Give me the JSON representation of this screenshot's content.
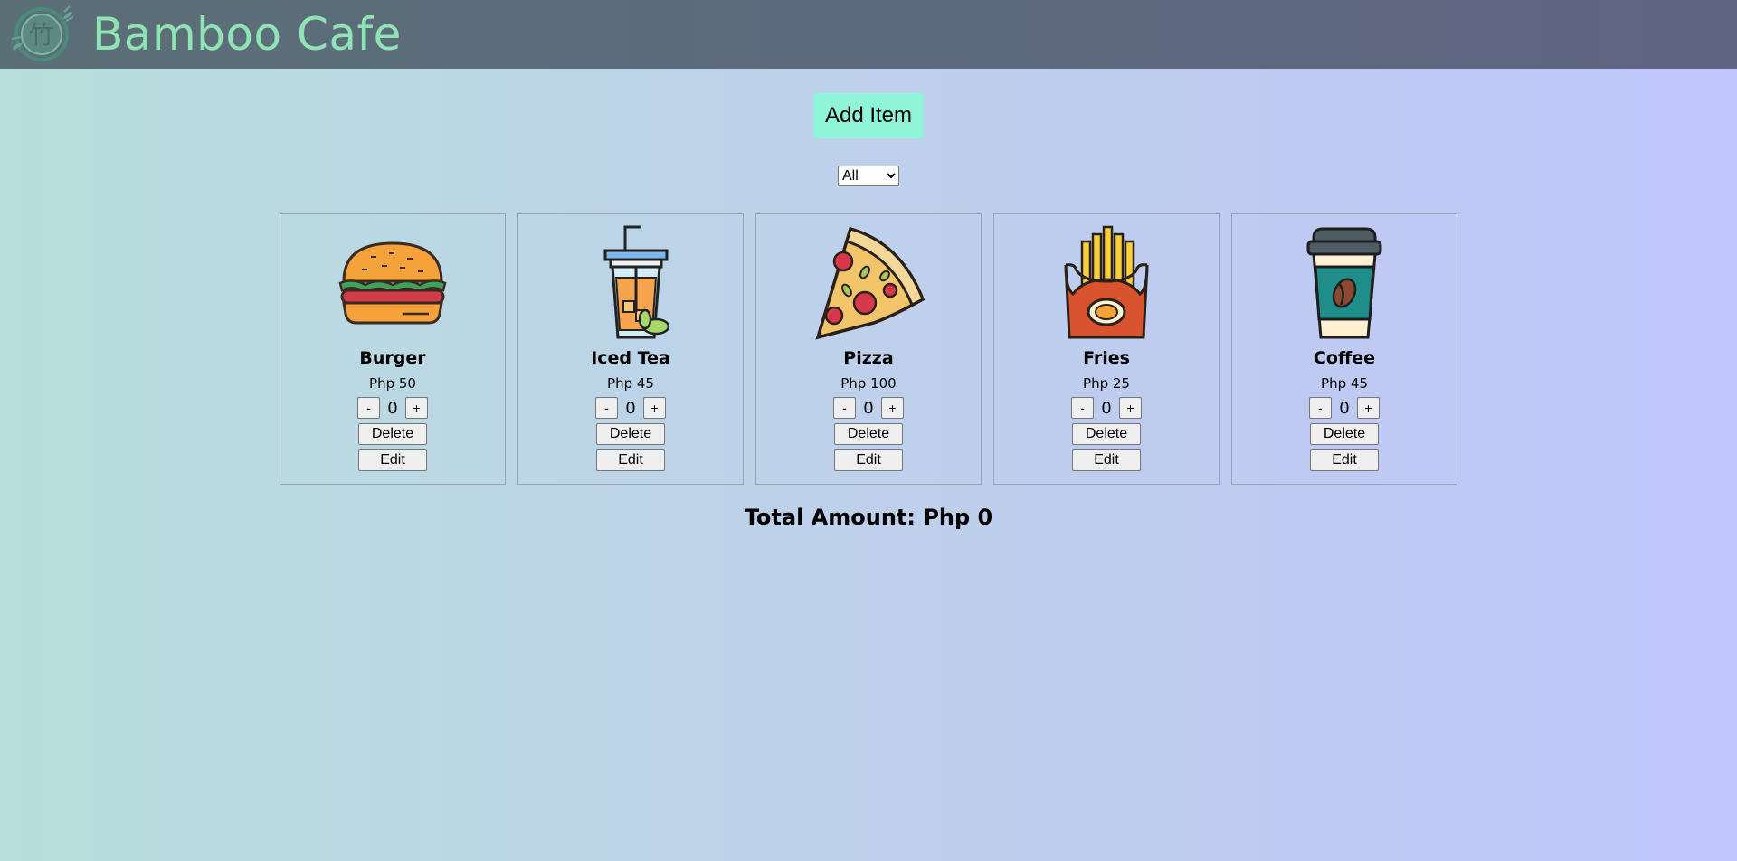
{
  "header": {
    "brand": "Bamboo Cafe",
    "logo_icon": "bamboo-logo-icon",
    "colors": {
      "bar": "#5d6a7e",
      "brand_text": "#8fe3b4"
    }
  },
  "toolbar": {
    "add_item_label": "Add Item",
    "add_button_color": "#90f4d9"
  },
  "filter": {
    "selected": "All"
  },
  "items": [
    {
      "name": "Burger",
      "price": "Php 50",
      "qty": "0",
      "icon": "burger-icon",
      "minus": "-",
      "plus": "+",
      "delete": "Delete",
      "edit": "Edit"
    },
    {
      "name": "Iced Tea",
      "price": "Php 45",
      "qty": "0",
      "icon": "iced-tea-icon",
      "minus": "-",
      "plus": "+",
      "delete": "Delete",
      "edit": "Edit"
    },
    {
      "name": "Pizza",
      "price": "Php 100",
      "qty": "0",
      "icon": "pizza-icon",
      "minus": "-",
      "plus": "+",
      "delete": "Delete",
      "edit": "Edit"
    },
    {
      "name": "Fries",
      "price": "Php 25",
      "qty": "0",
      "icon": "fries-icon",
      "minus": "-",
      "plus": "+",
      "delete": "Delete",
      "edit": "Edit"
    },
    {
      "name": "Coffee",
      "price": "Php 45",
      "qty": "0",
      "icon": "coffee-icon",
      "minus": "-",
      "plus": "+",
      "delete": "Delete",
      "edit": "Edit"
    }
  ],
  "total": {
    "text": "Total Amount: Php 0"
  }
}
